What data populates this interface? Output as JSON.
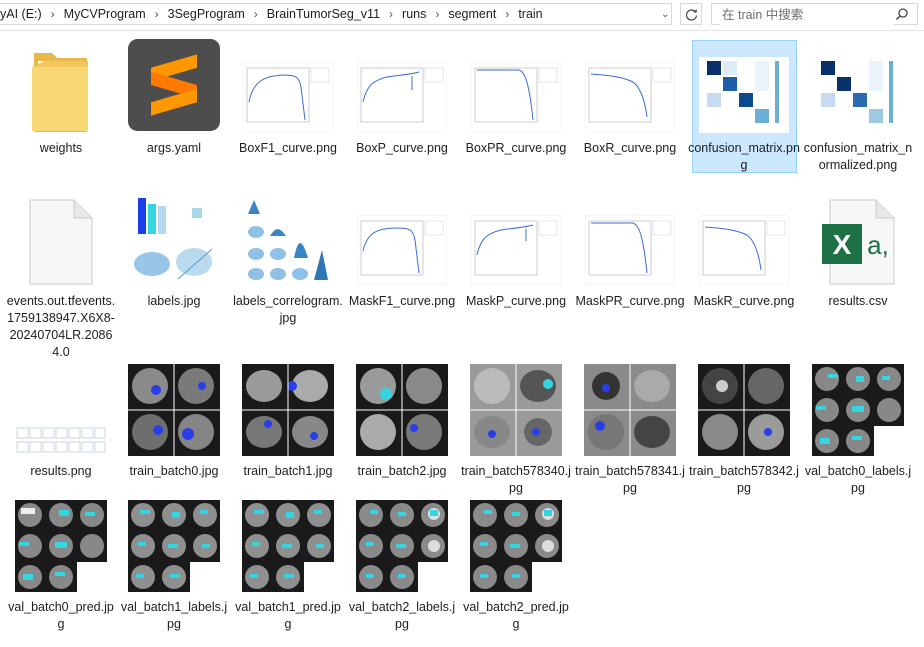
{
  "window": {
    "breadcrumb": [
      "yAI (E:)",
      "MyCVProgram",
      "3SegProgram",
      "BrainTumorSeg_v11",
      "runs",
      "segment",
      "train"
    ],
    "search_placeholder": "在 train 中搜索"
  },
  "files": [
    {
      "name": "weights",
      "icon": "folder-icon"
    },
    {
      "name": "args.yaml",
      "icon": "sublime-text-icon"
    },
    {
      "name": "BoxF1_curve.png",
      "icon": "curve-thumbnail"
    },
    {
      "name": "BoxP_curve.png",
      "icon": "curve-thumbnail"
    },
    {
      "name": "BoxPR_curve.png",
      "icon": "curve-thumbnail"
    },
    {
      "name": "BoxR_curve.png",
      "icon": "curve-thumbnail"
    },
    {
      "name": "confusion_matrix.png",
      "icon": "matrix-thumbnail",
      "selected": true
    },
    {
      "name": "confusion_matrix_normalized.png",
      "icon": "matrix-thumbnail"
    },
    {
      "name": "events.out.tfevents.1759138947.X6X8-20240704LR.20864.0",
      "icon": "blank-file-icon"
    },
    {
      "name": "labels.jpg",
      "icon": "labels-thumbnail"
    },
    {
      "name": "labels_correlogram.jpg",
      "icon": "correlogram-thumbnail"
    },
    {
      "name": "MaskF1_curve.png",
      "icon": "curve-thumbnail"
    },
    {
      "name": "MaskP_curve.png",
      "icon": "curve-thumbnail"
    },
    {
      "name": "MaskPR_curve.png",
      "icon": "curve-thumbnail"
    },
    {
      "name": "MaskR_curve.png",
      "icon": "curve-thumbnail"
    },
    {
      "name": "results.csv",
      "icon": "excel-csv-icon"
    },
    {
      "name": "results.png",
      "icon": "results-thumbnail"
    },
    {
      "name": "train_batch0.jpg",
      "icon": "mri-thumbnail"
    },
    {
      "name": "train_batch1.jpg",
      "icon": "mri-thumbnail"
    },
    {
      "name": "train_batch2.jpg",
      "icon": "mri-thumbnail"
    },
    {
      "name": "train_batch578340.jpg",
      "icon": "mri-thumbnail"
    },
    {
      "name": "train_batch578341.jpg",
      "icon": "mri-thumbnail"
    },
    {
      "name": "train_batch578342.jpg",
      "icon": "mri-thumbnail"
    },
    {
      "name": "val_batch0_labels.jpg",
      "icon": "mri-thumbnail"
    },
    {
      "name": "val_batch0_pred.jpg",
      "icon": "mri-thumbnail"
    },
    {
      "name": "val_batch1_labels.jpg",
      "icon": "mri-thumbnail"
    },
    {
      "name": "val_batch1_pred.jpg",
      "icon": "mri-thumbnail"
    },
    {
      "name": "val_batch2_labels.jpg",
      "icon": "mri-thumbnail"
    },
    {
      "name": "val_batch2_pred.jpg",
      "icon": "mri-thumbnail"
    }
  ],
  "colors": {
    "selection": "#cce8ff",
    "folder": "#f8d775",
    "sublime": "#ff9800",
    "excel": "#1e7145",
    "matrix": "#08306b",
    "segmentation": "#33d6e0"
  }
}
